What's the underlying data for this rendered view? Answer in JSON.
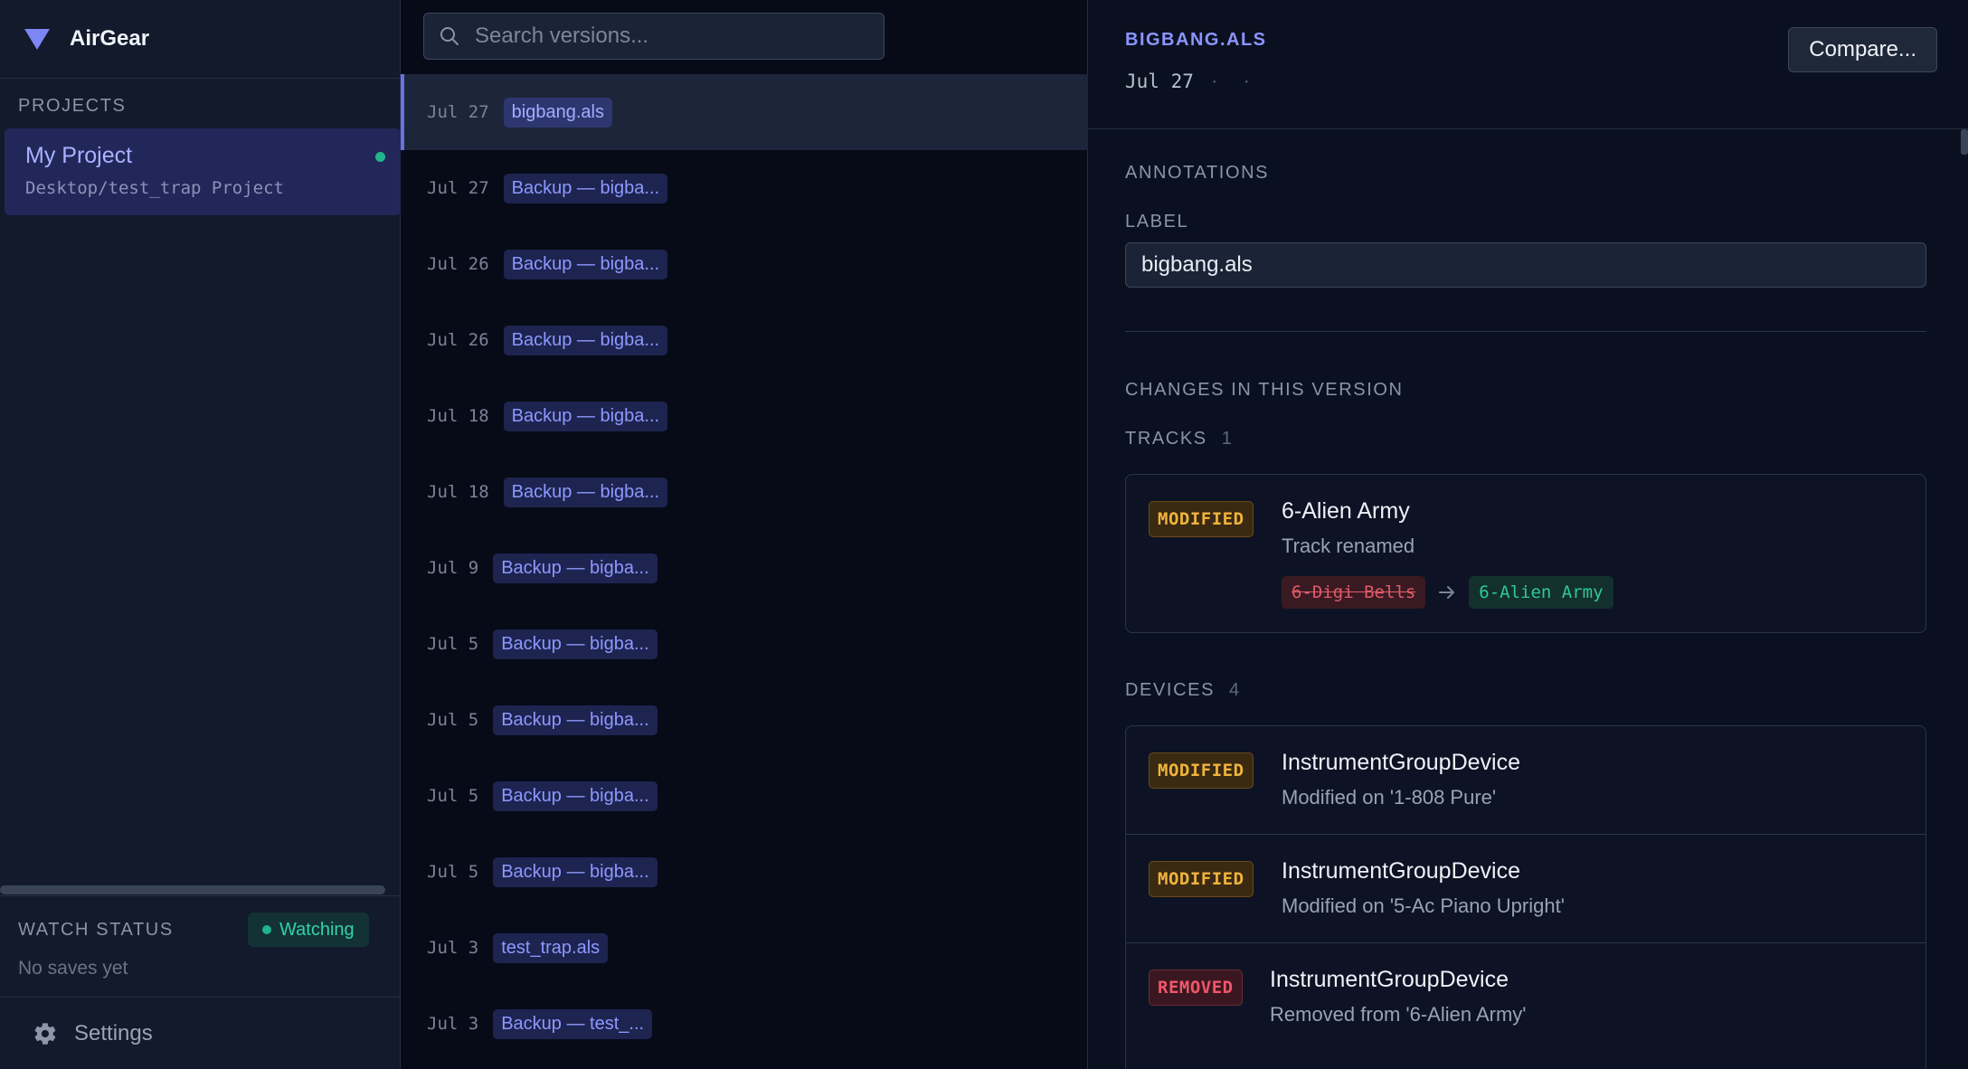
{
  "sidebar": {
    "brand": "AirGear",
    "projects_label": "PROJECTS",
    "project": {
      "name": "My Project",
      "path": "Desktop/test_trap Project"
    },
    "watch_status_label": "WATCH STATUS",
    "watch_badge": "Watching",
    "watch_empty": "No saves yet",
    "settings_label": "Settings"
  },
  "versions": {
    "search_placeholder": "Search versions...",
    "items": [
      {
        "date": "Jul 27",
        "label": "bigbang.als"
      },
      {
        "date": "Jul 27",
        "label": "Backup — bigba..."
      },
      {
        "date": "Jul 26",
        "label": "Backup — bigba..."
      },
      {
        "date": "Jul 26",
        "label": "Backup — bigba..."
      },
      {
        "date": "Jul 18",
        "label": "Backup — bigba..."
      },
      {
        "date": "Jul 18",
        "label": "Backup — bigba..."
      },
      {
        "date": "Jul 9",
        "label": "Backup — bigba..."
      },
      {
        "date": "Jul 5",
        "label": "Backup — bigba..."
      },
      {
        "date": "Jul 5",
        "label": "Backup — bigba..."
      },
      {
        "date": "Jul 5",
        "label": "Backup — bigba..."
      },
      {
        "date": "Jul 5",
        "label": "Backup — bigba..."
      },
      {
        "date": "Jul 3",
        "label": "test_trap.als"
      },
      {
        "date": "Jul 3",
        "label": "Backup — test_..."
      }
    ]
  },
  "detail": {
    "file_name": "BIGBANG.ALS",
    "date": "Jul 27",
    "sep1": "·",
    "sep2": "·",
    "compare_label": "Compare...",
    "annotations_label": "ANNOTATIONS",
    "label_label": "LABEL",
    "label_value": "bigbang.als",
    "changes_label": "CHANGES IN THIS VERSION",
    "tracks": {
      "label": "TRACKS",
      "count": "1",
      "items": [
        {
          "badge": "MODIFIED",
          "title": "6-Alien Army",
          "desc": "Track renamed",
          "old_name": "6-Digi Bells",
          "new_name": "6-Alien Army"
        }
      ]
    },
    "devices": {
      "label": "DEVICES",
      "count": "4",
      "items": [
        {
          "badge": "MODIFIED",
          "title": "InstrumentGroupDevice",
          "desc": "Modified on '1-808 Pure'"
        },
        {
          "badge": "MODIFIED",
          "title": "InstrumentGroupDevice",
          "desc": "Modified on '5-Ac Piano Upright'"
        },
        {
          "badge": "REMOVED",
          "title": "InstrumentGroupDevice",
          "desc": "Removed from '6-Alien Army'"
        }
      ]
    }
  },
  "colors": {
    "accent": "#8b95ff",
    "watching": "#34d3a4",
    "modified": "#f0b43c",
    "removed": "#f0566a"
  }
}
